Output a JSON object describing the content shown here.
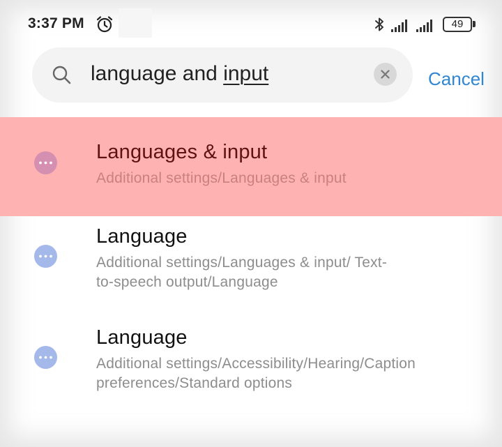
{
  "status_bar": {
    "time": "3:37 PM",
    "icons": [
      "alarm-clock-icon",
      "bluetooth-icon",
      "signal-icon",
      "signal-icon",
      "battery-icon"
    ],
    "battery_level": "49"
  },
  "search": {
    "query_prefix": "language and ",
    "query_underlined": "input",
    "icon": "search-icon",
    "clear_icon": "close-icon",
    "cancel_label": "Cancel"
  },
  "results": [
    {
      "title": "Languages & input",
      "path": "Additional settings/Languages & input",
      "highlighted": true,
      "icon": "more-dots-icon"
    },
    {
      "title": "Language",
      "path": "Additional settings/Languages & input/ Text-to-speech output/Language",
      "highlighted": false,
      "icon": "more-dots-icon"
    },
    {
      "title": "Language",
      "path": "Additional settings/Accessibility/Hearing/Caption preferences/Standard options",
      "highlighted": false,
      "icon": "more-dots-icon"
    }
  ],
  "colors": {
    "accent": "#2f86d2",
    "highlight": "#ffb2b2",
    "result_icon": "#a4b8ea",
    "highlight_icon": "#d58fb1"
  }
}
